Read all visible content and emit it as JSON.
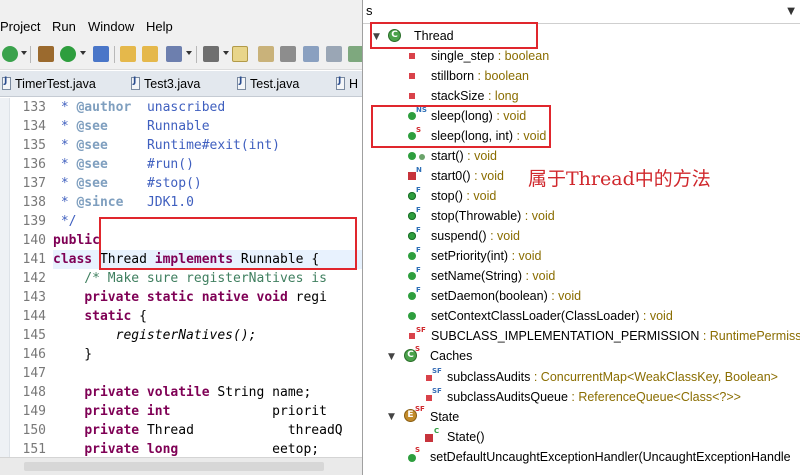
{
  "menu": [
    "Project",
    "Run",
    "Window",
    "Help"
  ],
  "tabs": [
    "TimerTest.java",
    "Test3.java",
    "Test.java",
    "H"
  ],
  "editor": {
    "line_numbers": [
      "133",
      "134",
      "135",
      "136",
      "137",
      "138",
      "139",
      "140",
      "141",
      "142",
      "143",
      "144",
      "145",
      "146",
      "147",
      "148",
      "149",
      "150",
      "151"
    ],
    "lines": [
      {
        "kind": "doc",
        "tag": "@author",
        "val": "unascribed"
      },
      {
        "kind": "doc",
        "tag": "@see",
        "val": "Runnable"
      },
      {
        "kind": "doc",
        "tag": "@see",
        "val": "Runtime#exit(int)"
      },
      {
        "kind": "doc",
        "tag": "@see",
        "val": "#run()"
      },
      {
        "kind": "doc",
        "tag": "@see",
        "val": "#stop()"
      },
      {
        "kind": "doc",
        "tag": "@since",
        "val": "JDK1.0"
      },
      {
        "kind": "docend",
        "text": " */"
      },
      {
        "kind": "code",
        "parts": [
          [
            "kw",
            "public"
          ]
        ]
      },
      {
        "kind": "code",
        "parts": [
          [
            "kw",
            "class"
          ],
          [
            "",
            "Thread"
          ],
          [
            "kw",
            "implements"
          ],
          [
            "",
            "Runnable {"
          ]
        ]
      },
      {
        "kind": "comment",
        "text": "    /* Make sure registerNatives is"
      },
      {
        "kind": "code",
        "parts": [
          [
            "",
            "    "
          ],
          [
            "kw",
            "private static native void"
          ],
          [
            "",
            "regi"
          ]
        ]
      },
      {
        "kind": "code",
        "parts": [
          [
            "",
            "    "
          ],
          [
            "kw",
            "static"
          ],
          [
            "",
            "{"
          ]
        ]
      },
      {
        "kind": "italic",
        "text": "        registerNatives();"
      },
      {
        "kind": "plain",
        "text": "    }"
      },
      {
        "kind": "plain",
        "text": ""
      },
      {
        "kind": "code",
        "parts": [
          [
            "",
            "    "
          ],
          [
            "kw",
            "private volatile"
          ],
          [
            "",
            "String name;"
          ]
        ]
      },
      {
        "kind": "code",
        "parts": [
          [
            "",
            "    "
          ],
          [
            "kw",
            "private int"
          ],
          [
            "",
            "            priorit"
          ]
        ]
      },
      {
        "kind": "code",
        "parts": [
          [
            "",
            "    "
          ],
          [
            "kw",
            "private"
          ],
          [
            "",
            "Thread            threadQ"
          ]
        ]
      },
      {
        "kind": "code",
        "parts": [
          [
            "",
            "    "
          ],
          [
            "kw",
            "private long"
          ],
          [
            "",
            "           eetop;"
          ]
        ]
      }
    ]
  },
  "outline": {
    "filter_value": "s",
    "root": "Thread",
    "items": [
      {
        "name": "single_step",
        "type": "boolean",
        "icon": "field",
        "deco": ""
      },
      {
        "name": "stillborn",
        "type": "boolean",
        "icon": "field",
        "deco": ""
      },
      {
        "name": "stackSize",
        "type": "long",
        "icon": "field",
        "deco": ""
      },
      {
        "name": "sleep(long)",
        "type": "void",
        "icon": "method",
        "deco": "NS"
      },
      {
        "name": "sleep(long, int)",
        "type": "void",
        "icon": "method",
        "deco": "S"
      },
      {
        "name": "start()",
        "type": "void",
        "icon": "method-sync",
        "deco": ""
      },
      {
        "name": "start0()",
        "type": "void",
        "icon": "private",
        "deco": "N"
      },
      {
        "name": "stop()",
        "type": "void",
        "icon": "method-deprecated",
        "deco": "F"
      },
      {
        "name": "stop(Throwable)",
        "type": "void",
        "icon": "method-deprecated",
        "deco": "F"
      },
      {
        "name": "suspend()",
        "type": "void",
        "icon": "method-deprecated",
        "deco": "F"
      },
      {
        "name": "setPriority(int)",
        "type": "void",
        "icon": "method",
        "deco": "F"
      },
      {
        "name": "setName(String)",
        "type": "void",
        "icon": "method",
        "deco": "F"
      },
      {
        "name": "setDaemon(boolean)",
        "type": "void",
        "icon": "method",
        "deco": "F"
      },
      {
        "name": "setContextClassLoader(ClassLoader)",
        "type": "void",
        "icon": "method",
        "deco": ""
      },
      {
        "name": "SUBCLASS_IMPLEMENTATION_PERMISSION",
        "type": "RuntimePermissio",
        "icon": "field",
        "deco": "SF"
      }
    ],
    "caches": {
      "name": "Caches",
      "children": [
        {
          "name": "subclassAudits",
          "type": "ConcurrentMap<WeakClassKey, Boolean>"
        },
        {
          "name": "subclassAuditsQueue",
          "type": "ReferenceQueue<Class<?>>"
        }
      ]
    },
    "state": {
      "name": "State",
      "children": [
        {
          "name": "State()",
          "type": ""
        }
      ]
    },
    "last": {
      "name": "setDefaultUncaughtExceptionHandler(UncaughtExceptionHandle",
      "type": ""
    },
    "annotation": "属于Thread中的方法"
  },
  "colors": {
    "highlight_box": "#e0262d",
    "field_icon": "#d9424a",
    "method_icon": "#2e9e3e",
    "type_text": "#8a6d00"
  }
}
